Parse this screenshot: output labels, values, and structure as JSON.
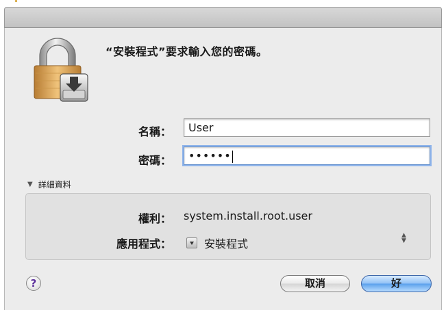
{
  "dialog": {
    "message": "“安裝程式”要求輸入您的密碼。",
    "name_label": "名稱：",
    "name_value": "User",
    "password_label": "密碼：",
    "password_value": "••••••",
    "details_toggle": "詳細資料",
    "right_label": "權利：",
    "right_value": "system.install.root.user",
    "app_label": "應用程式：",
    "app_value": "安裝程式",
    "help_label": "?",
    "cancel_label": "取消",
    "ok_label": "好"
  },
  "icons": {
    "lock": "lock-icon",
    "app": "installer-icon",
    "help": "help-icon",
    "disclosure": "disclosure-triangle-icon",
    "stepper": "updown-stepper-icon"
  },
  "colors": {
    "window_bg": "#ececec",
    "details_bg": "#e1e1e1",
    "ok_blue": "#5aa0ec",
    "focus_ring": "#8fb4ea",
    "lock_gold": "#d9a85a"
  }
}
